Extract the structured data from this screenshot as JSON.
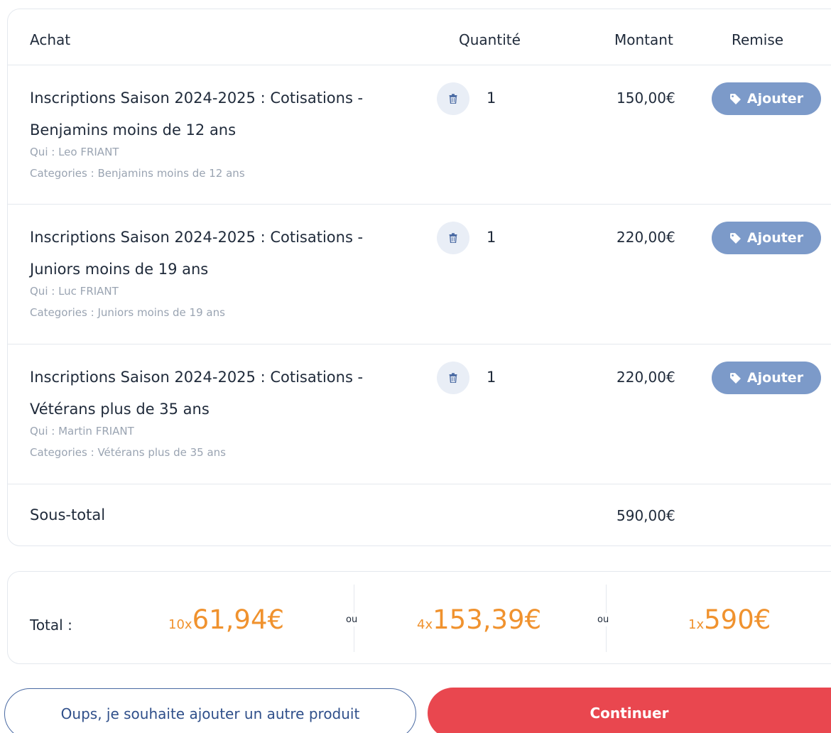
{
  "table": {
    "headers": {
      "achat": "Achat",
      "quantite": "Quantité",
      "montant": "Montant",
      "remise": "Remise"
    },
    "rows": [
      {
        "title": "Inscriptions Saison 2024-2025 : Cotisations - Benjamins moins de 12 ans",
        "qui": "Qui : Leo FRIANT",
        "categories": "Categories : Benjamins moins de 12 ans",
        "quantity": "1",
        "amount": "150,00€",
        "discount_label": "Ajouter"
      },
      {
        "title": "Inscriptions Saison 2024-2025 : Cotisations - Juniors moins de 19 ans",
        "qui": "Qui : Luc FRIANT",
        "categories": "Categories : Juniors moins de 19 ans",
        "quantity": "1",
        "amount": "220,00€",
        "discount_label": "Ajouter"
      },
      {
        "title": "Inscriptions Saison 2024-2025 : Cotisations - Vétérans plus de 35 ans",
        "qui": "Qui : Martin FRIANT",
        "categories": "Categories : Vétérans plus de 35 ans",
        "quantity": "1",
        "amount": "220,00€",
        "discount_label": "Ajouter"
      }
    ],
    "subtotal_label": "Sous-total",
    "subtotal_value": "590,00€"
  },
  "total": {
    "label": "Total :",
    "separator": "ou",
    "options": [
      {
        "multiplier": "10x",
        "price": "61,94€"
      },
      {
        "multiplier": "4x",
        "price": "153,39€"
      },
      {
        "multiplier": "1x",
        "price": "590€"
      }
    ]
  },
  "actions": {
    "back_label": "Oups, je souhaite ajouter un autre produit",
    "continue_label": "Continuer"
  },
  "colors": {
    "accent_orange": "#f0922e",
    "continue_red": "#e9474f",
    "discount_blue": "#7c9ac9",
    "border_blue": "#4a6aa3"
  },
  "icons": {
    "trash": "trash-icon",
    "tag": "tag-icon"
  }
}
